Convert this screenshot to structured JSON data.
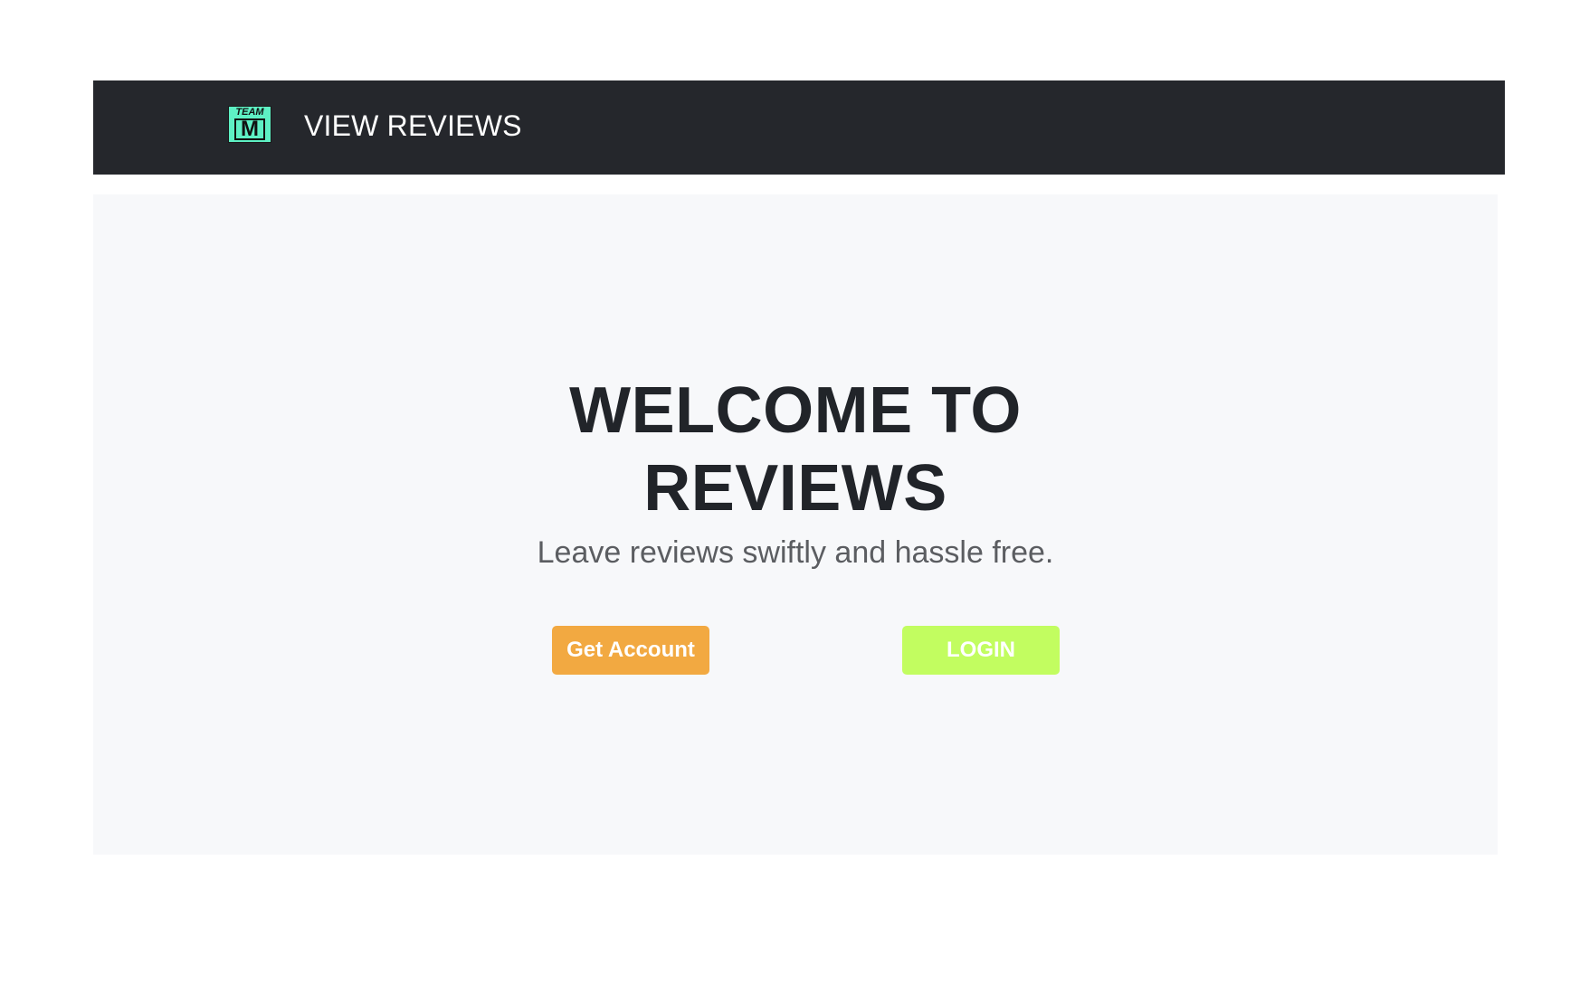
{
  "navbar": {
    "logo": {
      "top_text": "TEAM",
      "letter": "M",
      "background_color": "#5ef0c4"
    },
    "link_label": "VIEW REVIEWS",
    "background_color": "#25272c"
  },
  "hero": {
    "title_line1": "WELCOME TO",
    "title_line2": "REVIEWS",
    "subtitle": "Leave reviews swiftly and hassle free.",
    "background_color": "#f7f8fa",
    "buttons": {
      "get_account": {
        "label": "Get Account",
        "color": "#f2a941"
      },
      "login": {
        "label": "LOGIN",
        "color": "#c2fd60"
      }
    }
  }
}
